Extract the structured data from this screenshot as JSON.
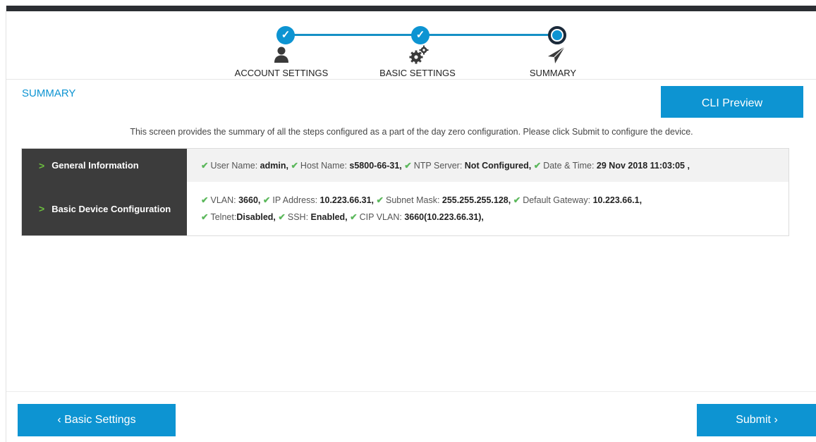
{
  "stepper": {
    "steps": [
      {
        "label": "ACCOUNT SETTINGS",
        "state": "complete",
        "icon": "user-icon"
      },
      {
        "label": "BASIC SETTINGS",
        "state": "complete",
        "icon": "gears-icon"
      },
      {
        "label": "SUMMARY",
        "state": "current",
        "icon": "paper-plane-icon"
      }
    ],
    "check_glyph": "✓"
  },
  "summary": {
    "title": "SUMMARY",
    "cli_preview_label": "CLI Preview",
    "description": "This screen provides the summary of all the steps configured as a part of the day zero configuration. Please click Submit to configure the device."
  },
  "table": {
    "rows": [
      {
        "header": "General Information",
        "lines": [
          [
            {
              "label": "User Name:",
              "value": "admin,"
            },
            {
              "label": "Host Name:",
              "value": "s5800-66-31,"
            },
            {
              "label": "NTP Server:",
              "value": "Not Configured,"
            },
            {
              "label": "Date & Time:",
              "value": "29 Nov 2018 11:03:05 ,"
            }
          ]
        ]
      },
      {
        "header": "Basic Device Configuration",
        "lines": [
          [
            {
              "label": "VLAN:",
              "value": "3660,"
            },
            {
              "label": "IP Address:",
              "value": "10.223.66.31,"
            },
            {
              "label": "Subnet Mask:",
              "value": "255.255.255.128,"
            },
            {
              "label": "Default Gateway:",
              "value": "10.223.66.1,"
            }
          ],
          [
            {
              "label": "Telnet:",
              "value": "Disabled,"
            },
            {
              "label": "SSH:",
              "value": "Enabled,"
            },
            {
              "label": "CIP VLAN:",
              "value": "3660(10.223.66.31),"
            }
          ]
        ]
      }
    ]
  },
  "footer": {
    "back_label": "‹ Basic Settings",
    "submit_label": "Submit ›"
  },
  "colors": {
    "accent": "#0d94d2",
    "dark": "#3c3c3c",
    "check": "#5cb85c"
  }
}
